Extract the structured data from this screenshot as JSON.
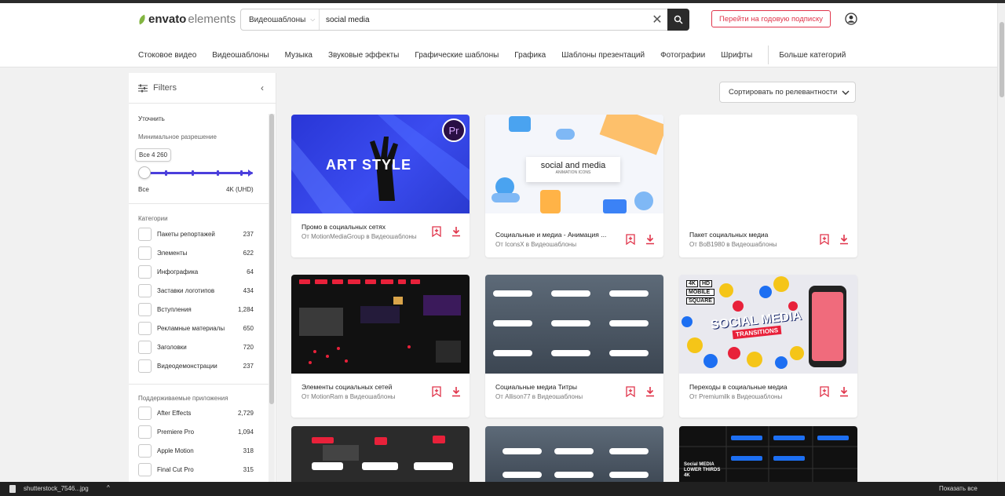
{
  "header": {
    "logo": {
      "brand": "envato",
      "product": "elements"
    },
    "search": {
      "category": "Видеошаблоны",
      "query": "social media"
    },
    "subscribe_label": "Перейти на годовую подписку"
  },
  "nav": {
    "items": [
      "Стоковое видео",
      "Видеошаблоны",
      "Музыка",
      "Звуковые эффекты",
      "Графические шаблоны",
      "Графика",
      "Шаблоны презентаций",
      "Фотографии",
      "Шрифты"
    ],
    "more": "Больше категорий"
  },
  "sidebar": {
    "title": "Filters",
    "refine": "Уточнить",
    "resolution": {
      "label": "Минимальное разрешение",
      "tooltip": "Все 4 260",
      "min_label": "Все",
      "max_label": "4K (UHD)",
      "selected_position": 0
    },
    "categories_title": "Категории",
    "categories": [
      {
        "label": "Пакеты репортажей",
        "count": "237"
      },
      {
        "label": "Элементы",
        "count": "622"
      },
      {
        "label": "Инфографика",
        "count": "64"
      },
      {
        "label": "Заставки логотипов",
        "count": "434"
      },
      {
        "label": "Вступления",
        "count": "1,284"
      },
      {
        "label": "Рекламные материалы",
        "count": "650"
      },
      {
        "label": "Заголовки",
        "count": "720"
      },
      {
        "label": "Видеодемонстрации",
        "count": "237"
      }
    ],
    "apps_title": "Поддерживаемые приложения",
    "apps": [
      {
        "label": "After Effects",
        "count": "2,729"
      },
      {
        "label": "Premiere Pro",
        "count": "1,094"
      },
      {
        "label": "Apple Motion",
        "count": "318"
      },
      {
        "label": "Final Cut Pro",
        "count": "315"
      }
    ]
  },
  "sort_label": "Сортировать по релевантности",
  "cards": [
    {
      "title": "Промо в социальных сетях",
      "author": "От MotionMediaGroup в Видеошаблоны",
      "thumb_text": "ART STYLE",
      "badge": "Pr"
    },
    {
      "title": "Социальные и медиа - Анимация ...",
      "author": "От IconsX в Видеошаблоны",
      "thumb_text": "social and media",
      "thumb_sub": "ANIMATION ICONS"
    },
    {
      "title": "Пакет социальных медиа",
      "author": "От BoB1980 в Видеошаблоны"
    },
    {
      "title": "Элементы социальных сетей",
      "author": "От MotionRam в Видеошаблоны"
    },
    {
      "title": "Социальные медиа Титры",
      "author": "От Allison77 в Видеошаблоны"
    },
    {
      "title": "Переходы в социальные медиа",
      "author": "От Premiumilk в Видеошаблоны",
      "thumb_text": "SOCIAL MEDIA",
      "thumb_sub": "TRANSITIONS",
      "tags": [
        "4K",
        "HD",
        "MOBILE",
        "SQUARE"
      ]
    },
    {
      "title": "",
      "author": ""
    },
    {
      "title": "",
      "author": ""
    },
    {
      "title": "",
      "author": "",
      "thumb_text": "Social MEDIA LOWER THIRDS 4K"
    }
  ],
  "taskbar": {
    "file": "shutterstock_7546...jpg",
    "show_all": "Показать все"
  },
  "colors": {
    "accent": "#e0344a",
    "slider": "#4b3fdc",
    "brand_green": "#82b541"
  }
}
